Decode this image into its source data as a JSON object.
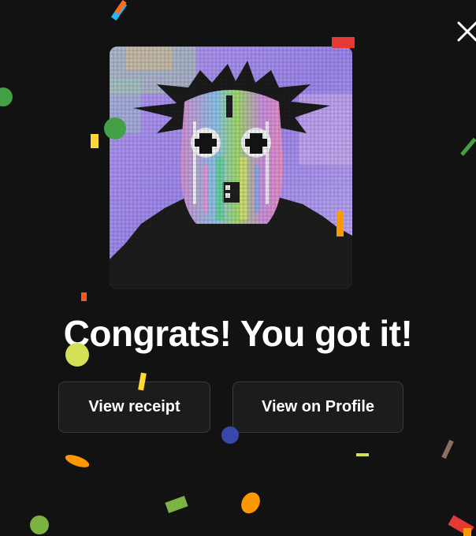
{
  "modal": {
    "title": "Congrats! You got it!",
    "buttons": {
      "view_receipt": "View receipt",
      "view_on_profile": "View on Profile"
    },
    "close_icon": "close-icon",
    "artwork": "pixel-art-masked-figure"
  },
  "colors": {
    "background": "#121212",
    "button_bg": "#1c1c1c",
    "button_border": "#3a3a3a",
    "text": "#ffffff",
    "art_purple": "#a98ef0",
    "confetti": [
      "#e53935",
      "#2e7d32",
      "#5cb85c",
      "#fdd835",
      "#ff9800",
      "#3949ab",
      "#d4e157",
      "#8d6e63",
      "#29b6f6"
    ]
  }
}
